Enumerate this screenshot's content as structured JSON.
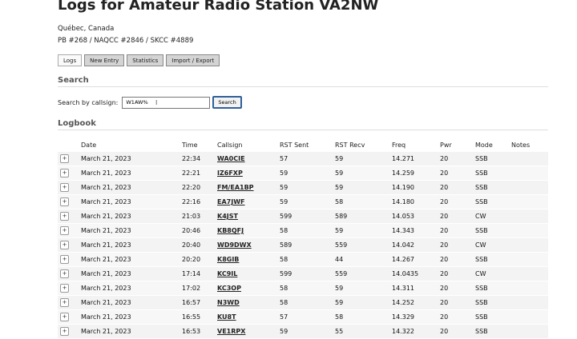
{
  "header": {
    "title": "Logs for Amateur Radio Station VA2NW",
    "location": "Québec, Canada",
    "numbers": "PB #268 / NAQCC #2846 / SKCC #4889"
  },
  "tabs": [
    {
      "label": "Logs",
      "active": true
    },
    {
      "label": "New Entry",
      "active": false
    },
    {
      "label": "Statistics",
      "active": false
    },
    {
      "label": "Import / Export",
      "active": false
    }
  ],
  "search": {
    "heading": "Search",
    "label": "Search by callsign:",
    "value": "W1AW%",
    "button": "Search"
  },
  "logbook": {
    "heading": "Logbook",
    "expand_symbol": "+",
    "columns": [
      "",
      "Date",
      "Time",
      "Callsign",
      "RST Sent",
      "RST Recv",
      "Freq",
      "Pwr",
      "Mode",
      "Notes"
    ],
    "rows": [
      {
        "date": "March 21, 2023",
        "time": "22:34",
        "call": "WA0CIE",
        "sent": "57",
        "recv": "59",
        "freq": "14.271",
        "pwr": "20",
        "mode": "SSB",
        "notes": ""
      },
      {
        "date": "March 21, 2023",
        "time": "22:21",
        "call": "IZ6FXP",
        "sent": "59",
        "recv": "59",
        "freq": "14.259",
        "pwr": "20",
        "mode": "SSB",
        "notes": ""
      },
      {
        "date": "March 21, 2023",
        "time": "22:20",
        "call": "FM/EA1BP",
        "sent": "59",
        "recv": "59",
        "freq": "14.190",
        "pwr": "20",
        "mode": "SSB",
        "notes": ""
      },
      {
        "date": "March 21, 2023",
        "time": "22:16",
        "call": "EA7JWF",
        "sent": "59",
        "recv": "58",
        "freq": "14.180",
        "pwr": "20",
        "mode": "SSB",
        "notes": ""
      },
      {
        "date": "March 21, 2023",
        "time": "21:03",
        "call": "K4JST",
        "sent": "599",
        "recv": "589",
        "freq": "14.053",
        "pwr": "20",
        "mode": "CW",
        "notes": ""
      },
      {
        "date": "March 21, 2023",
        "time": "20:46",
        "call": "KB8QFJ",
        "sent": "58",
        "recv": "59",
        "freq": "14.343",
        "pwr": "20",
        "mode": "SSB",
        "notes": ""
      },
      {
        "date": "March 21, 2023",
        "time": "20:40",
        "call": "WD9DWX",
        "sent": "589",
        "recv": "559",
        "freq": "14.042",
        "pwr": "20",
        "mode": "CW",
        "notes": ""
      },
      {
        "date": "March 21, 2023",
        "time": "20:20",
        "call": "K8GIB",
        "sent": "58",
        "recv": "44",
        "freq": "14.267",
        "pwr": "20",
        "mode": "SSB",
        "notes": ""
      },
      {
        "date": "March 21, 2023",
        "time": "17:14",
        "call": "KC9IL",
        "sent": "599",
        "recv": "559",
        "freq": "14.0435",
        "pwr": "20",
        "mode": "CW",
        "notes": ""
      },
      {
        "date": "March 21, 2023",
        "time": "17:02",
        "call": "KC3OP",
        "sent": "58",
        "recv": "59",
        "freq": "14.311",
        "pwr": "20",
        "mode": "SSB",
        "notes": ""
      },
      {
        "date": "March 21, 2023",
        "time": "16:57",
        "call": "N3WD",
        "sent": "58",
        "recv": "59",
        "freq": "14.252",
        "pwr": "20",
        "mode": "SSB",
        "notes": ""
      },
      {
        "date": "March 21, 2023",
        "time": "16:55",
        "call": "KU8T",
        "sent": "57",
        "recv": "58",
        "freq": "14.329",
        "pwr": "20",
        "mode": "SSB",
        "notes": ""
      },
      {
        "date": "March 21, 2023",
        "time": "16:53",
        "call": "VE1RPX",
        "sent": "59",
        "recv": "55",
        "freq": "14.322",
        "pwr": "20",
        "mode": "SSB",
        "notes": ""
      }
    ]
  }
}
